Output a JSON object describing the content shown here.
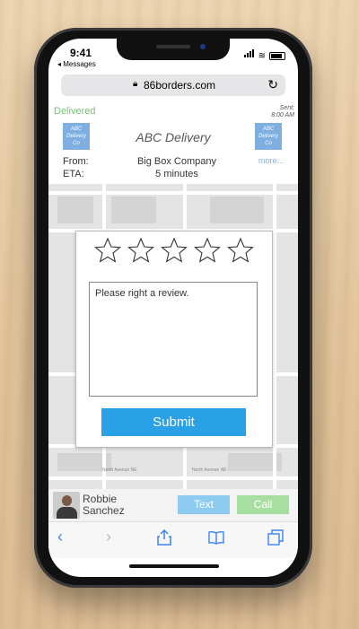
{
  "status": {
    "time": "9:41",
    "back_label": "◂ Messages"
  },
  "browser": {
    "url": "86borders.com"
  },
  "header": {
    "status": "Delivered",
    "sent_label": "Sent:",
    "sent_time": "8:00 AM",
    "brand": "ABC Delivery",
    "logo_text": "ABC Delivery Co",
    "from_label": "From:",
    "from_value": "Big Box Company",
    "eta_label": "ETA:",
    "eta_value": "5 minutes",
    "more_link": "more..."
  },
  "review": {
    "rating": 0,
    "max_rating": 5,
    "placeholder": "Please right a review.",
    "submit_label": "Submit"
  },
  "map": {
    "street_label_1": "North Avenue NE",
    "street_label_2": "North Avenue NE"
  },
  "driver": {
    "first_name": "Robbie",
    "last_name": "Sanchez",
    "text_label": "Text",
    "call_label": "Call"
  },
  "colors": {
    "accent": "#2aa1e6",
    "text_btn": "#8dcbf0",
    "call_btn": "#a7dfa0",
    "delivered": "#6bc76b"
  }
}
